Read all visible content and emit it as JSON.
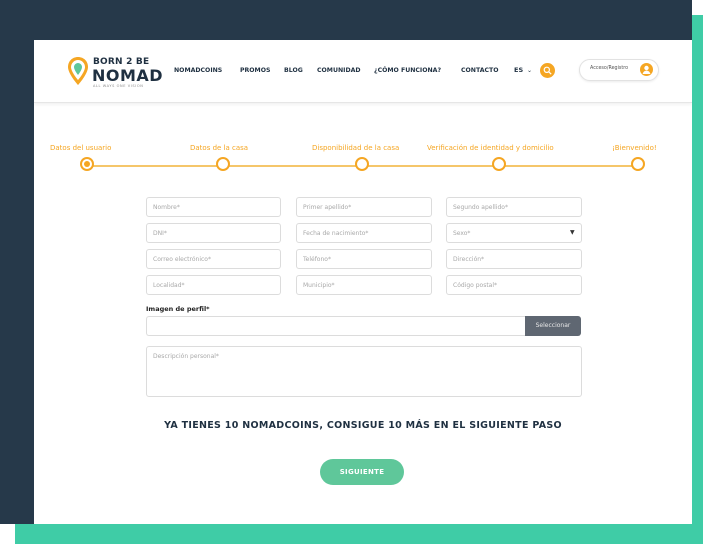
{
  "brand": {
    "line1": "BORN 2 BE",
    "line2": "NOMAD",
    "tagline": "ALL WAYS ONE VISION",
    "accent": "#f5a623",
    "green": "#5fc79a",
    "dark": "#26394a",
    "teal": "#3fcca6"
  },
  "nav": {
    "items": [
      "NOMADCOINS",
      "PROMOS",
      "BLOG",
      "COMUNIDAD",
      "¿CÓMO FUNCIONA?",
      "CONTACTO"
    ],
    "language": "ES",
    "search_icon": "search-icon",
    "access_label": "Acceso/Registro",
    "user_icon": "user-icon"
  },
  "steps": [
    {
      "label": "Datos del usuario",
      "active": true
    },
    {
      "label": "Datos de la casa",
      "active": false
    },
    {
      "label": "Disponibilidad de la casa",
      "active": false
    },
    {
      "label": "Verificación de identidad y domicilio",
      "active": false
    },
    {
      "label": "¡Bienvenido!",
      "active": false
    }
  ],
  "form": {
    "nombre": "Nombre*",
    "primer_apellido": "Primer apellido*",
    "segundo_apellido": "Segundo apellido*",
    "dni": "DNI*",
    "fecha_nacimiento": "Fecha de nacimiento*",
    "sexo": "Sexo*",
    "correo": "Correo electrónico*",
    "telefono": "Teléfono*",
    "direccion": "Dirección*",
    "localidad": "Localidad*",
    "municipio": "Municipio*",
    "codigo_postal": "Código postal*",
    "imagen_label": "Imagen de perfil*",
    "seleccionar": "Seleccionar",
    "descripcion": "Descripción personal*"
  },
  "promo_text": "YA TIENES 10 NOMADCOINS, CONSIGUE 10 MÁS EN EL SIGUIENTE PASO",
  "next_button": "SIGUIENTE"
}
